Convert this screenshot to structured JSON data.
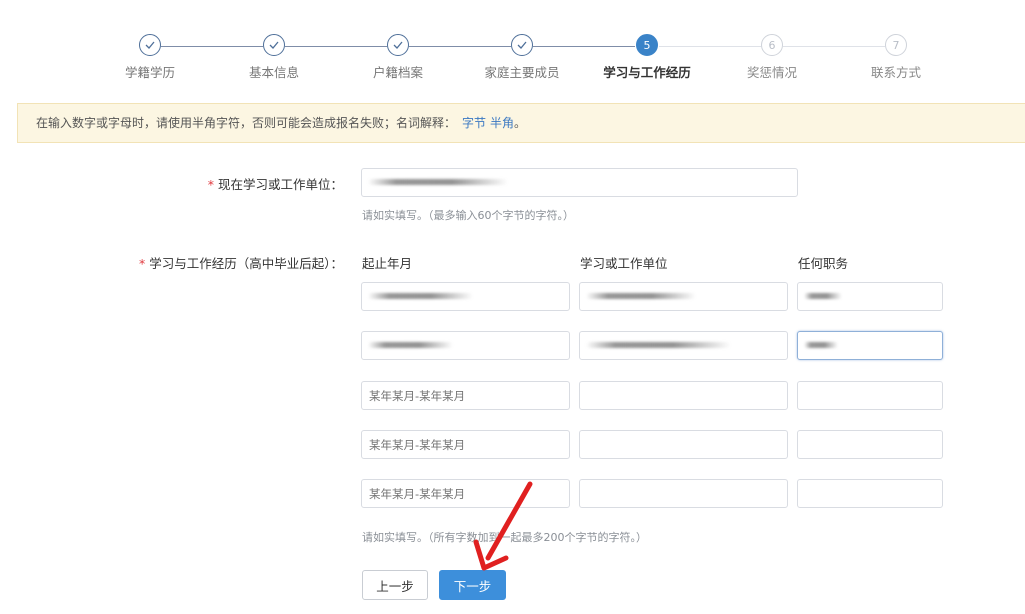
{
  "steps": [
    {
      "label": "学籍学历",
      "status": "done"
    },
    {
      "label": "基本信息",
      "status": "done"
    },
    {
      "label": "户籍档案",
      "status": "done"
    },
    {
      "label": "家庭主要成员",
      "status": "done"
    },
    {
      "label": "学习与工作经历",
      "status": "active",
      "number": "5"
    },
    {
      "label": "奖惩情况",
      "status": "todo",
      "number": "6"
    },
    {
      "label": "联系方式",
      "status": "todo",
      "number": "7"
    }
  ],
  "notice": {
    "text": "在输入数字或字母时，请使用半角字符，否则可能会造成报名失败；名词解释：",
    "link1": "字节",
    "link2": "半角",
    "end": "。"
  },
  "form": {
    "current_unit": {
      "required_mark": "*",
      "label": "现在学习或工作单位：",
      "hint": "请如实填写。（最多输入60个字节的字符。）"
    },
    "history": {
      "required_mark": "*",
      "label": "学习与工作经历（高中毕业后起）：",
      "columns": [
        "起止年月",
        "学习或工作单位",
        "任何职务"
      ],
      "placeholder": "某年某月-某年某月",
      "hint": "请如实填写。（所有字数加到一起最多200个字节的字符。）"
    }
  },
  "buttons": {
    "prev": "上一步",
    "next": "下一步"
  },
  "colors": {
    "accent": "#3d8fdb",
    "required": "#e0393e",
    "notice_bg": "#fcf6e2",
    "annotation_arrow": "#e02020"
  }
}
